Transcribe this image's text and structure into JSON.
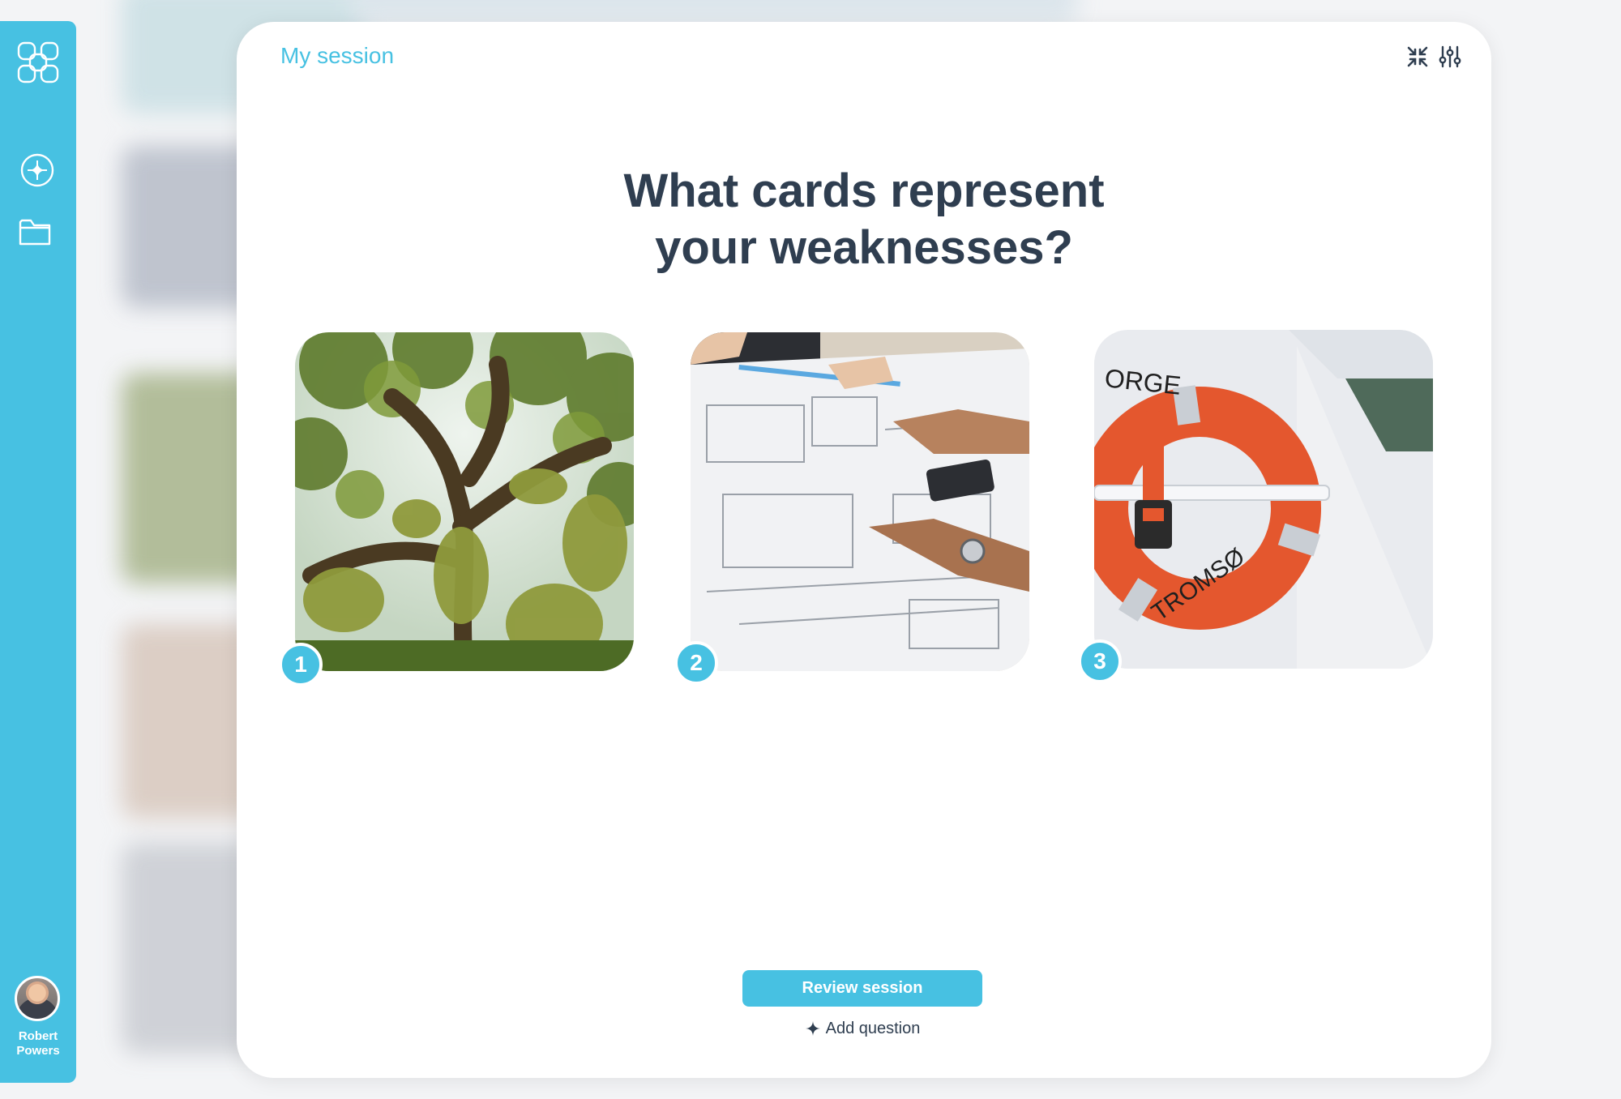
{
  "sidebar": {
    "user_first": "Robert",
    "user_last": "Powers"
  },
  "header": {
    "title": "My session"
  },
  "question": {
    "line1": "What cards represent",
    "line2": "your weaknesses?"
  },
  "cards": [
    {
      "badge": "1",
      "image": "mossy-trees"
    },
    {
      "badge": "2",
      "image": "architectural-blueprints"
    },
    {
      "badge": "3",
      "image": "orange-lifebuoy"
    }
  ],
  "footer": {
    "review_label": "Review session",
    "add_question_label": "Add question"
  },
  "colors": {
    "accent": "#47c1e2",
    "heading": "#2f3e50"
  }
}
